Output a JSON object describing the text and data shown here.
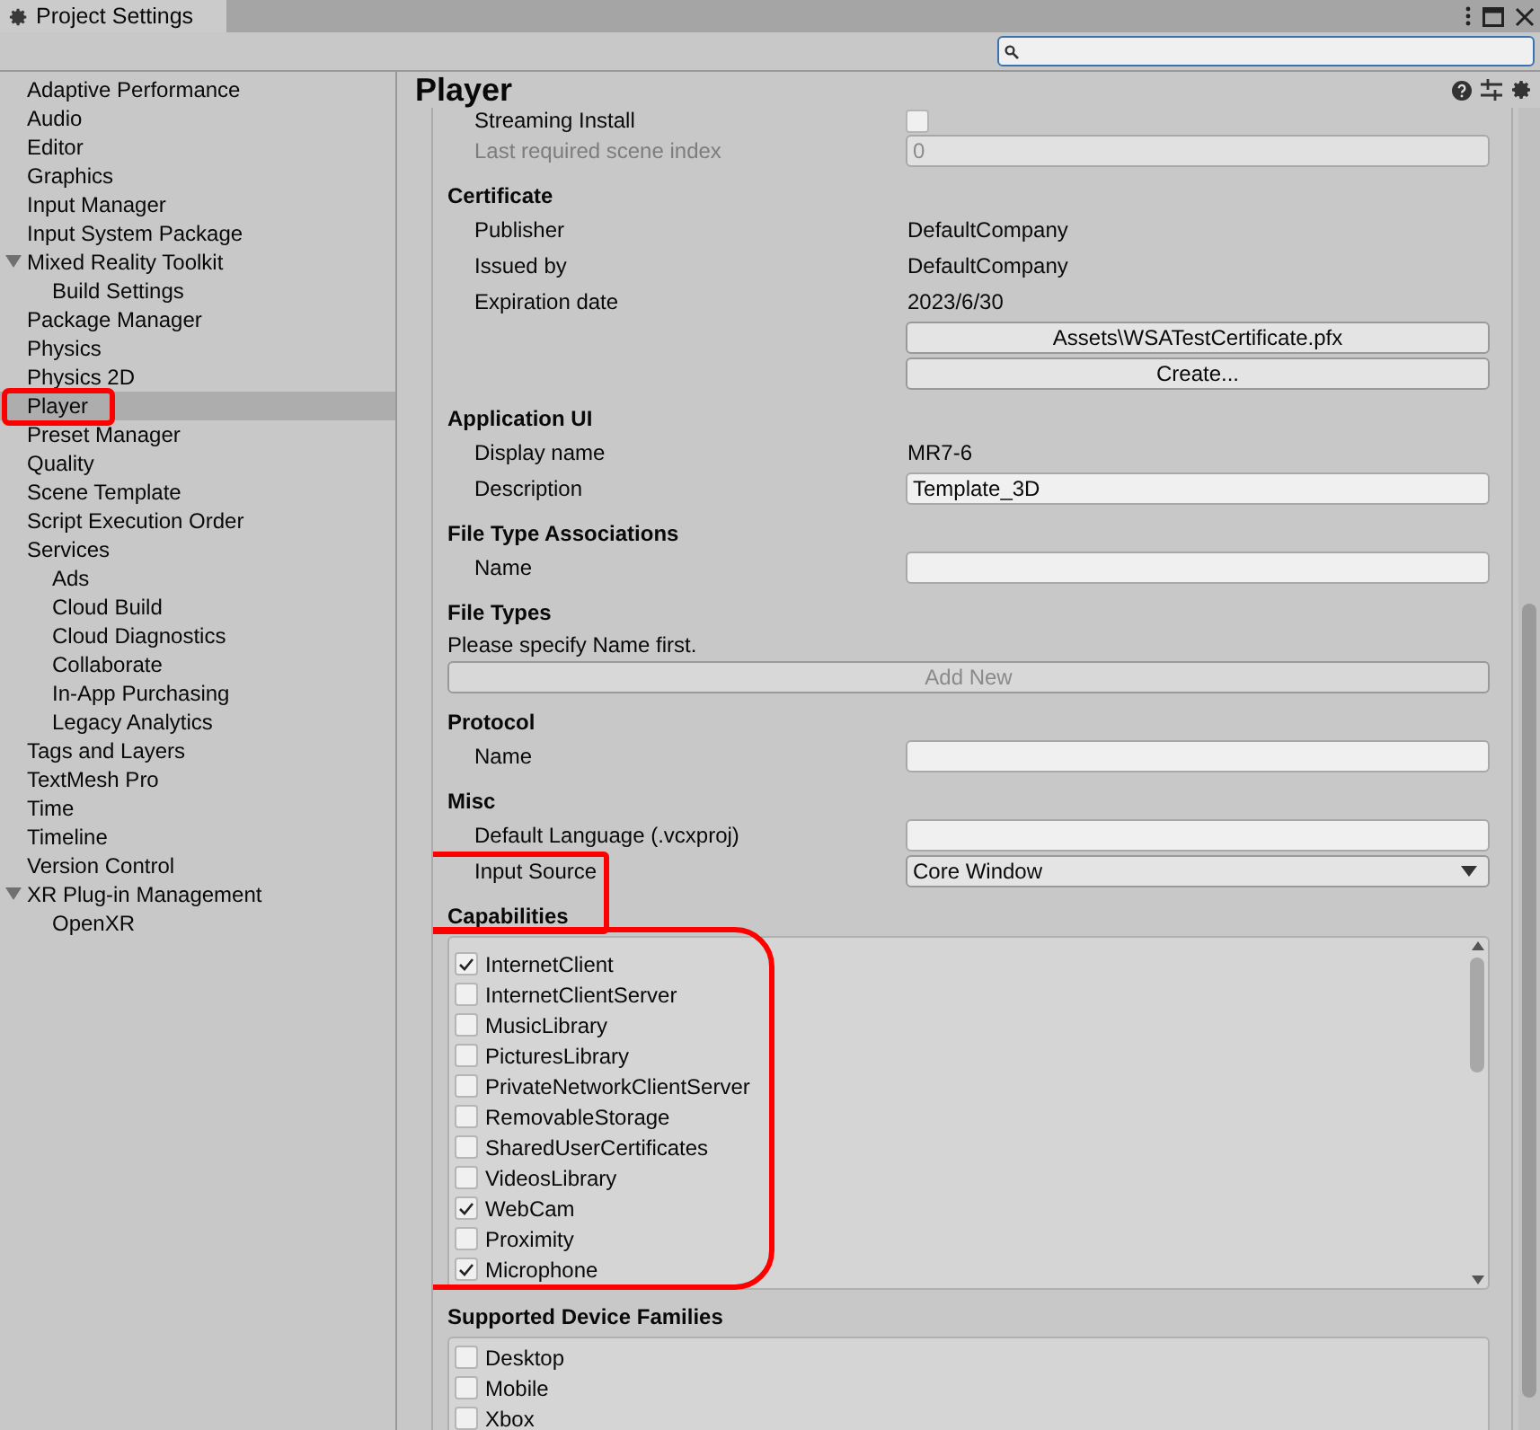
{
  "window": {
    "title": "Project Settings"
  },
  "sidebar": {
    "items": [
      {
        "label": "Adaptive Performance",
        "selected": false,
        "highlighted": false
      },
      {
        "label": "Audio",
        "selected": false,
        "highlighted": false
      },
      {
        "label": "Editor",
        "selected": false,
        "highlighted": false
      },
      {
        "label": "Graphics",
        "selected": false,
        "highlighted": false
      },
      {
        "label": "Input Manager",
        "selected": false,
        "highlighted": false
      },
      {
        "label": "Input System Package",
        "selected": false,
        "highlighted": false
      },
      {
        "label": "Mixed Reality Toolkit",
        "selected": false,
        "highlighted": false,
        "expanded": true,
        "children": [
          {
            "label": "Build Settings",
            "selected": false,
            "highlighted": false
          }
        ]
      },
      {
        "label": "Package Manager",
        "selected": false,
        "highlighted": false
      },
      {
        "label": "Physics",
        "selected": false,
        "highlighted": false
      },
      {
        "label": "Physics 2D",
        "selected": false,
        "highlighted": false
      },
      {
        "label": "Player",
        "selected": true,
        "highlighted": true
      },
      {
        "label": "Preset Manager",
        "selected": false,
        "highlighted": false
      },
      {
        "label": "Quality",
        "selected": false,
        "highlighted": false
      },
      {
        "label": "Scene Template",
        "selected": false,
        "highlighted": false
      },
      {
        "label": "Script Execution Order",
        "selected": false,
        "highlighted": false
      },
      {
        "label": "Services",
        "selected": false,
        "highlighted": false,
        "children": [
          {
            "label": "Ads",
            "selected": false,
            "highlighted": false
          },
          {
            "label": "Cloud Build",
            "selected": false,
            "highlighted": false
          },
          {
            "label": "Cloud Diagnostics",
            "selected": false,
            "highlighted": false
          },
          {
            "label": "Collaborate",
            "selected": false,
            "highlighted": false
          },
          {
            "label": "In-App Purchasing",
            "selected": false,
            "highlighted": false
          },
          {
            "label": "Legacy Analytics",
            "selected": false,
            "highlighted": false
          }
        ]
      },
      {
        "label": "Tags and Layers",
        "selected": false,
        "highlighted": false
      },
      {
        "label": "TextMesh Pro",
        "selected": false,
        "highlighted": false
      },
      {
        "label": "Time",
        "selected": false,
        "highlighted": false
      },
      {
        "label": "Timeline",
        "selected": false,
        "highlighted": false
      },
      {
        "label": "Version Control",
        "selected": false,
        "highlighted": false
      },
      {
        "label": "XR Plug-in Management",
        "selected": false,
        "highlighted": false,
        "expanded": true,
        "children": [
          {
            "label": "OpenXR",
            "selected": false,
            "highlighted": false
          }
        ]
      }
    ]
  },
  "panel": {
    "title": "Player",
    "sections": [
      {
        "rows": [
          {
            "kind": "toggle",
            "label": "Streaming Install",
            "checked": false
          },
          {
            "kind": "field",
            "label": "Last required scene index",
            "value": "0",
            "disabled": true
          }
        ]
      },
      {
        "heading": "Certificate",
        "highlighted": false,
        "rows": [
          {
            "kind": "info",
            "label": "Publisher",
            "value": "DefaultCompany"
          },
          {
            "kind": "info",
            "label": "Issued by",
            "value": "DefaultCompany"
          },
          {
            "kind": "info",
            "label": "Expiration date",
            "value": "2023/6/30"
          },
          {
            "kind": "button",
            "label": "Assets\\WSATestCertificate.pfx"
          },
          {
            "kind": "button",
            "label": "Create..."
          }
        ]
      },
      {
        "heading": "Application UI",
        "highlighted": false,
        "rows": [
          {
            "kind": "info",
            "label": "Display name",
            "value": "MR7-6"
          },
          {
            "kind": "field",
            "label": "Description",
            "value": "Template_3D",
            "disabled": false
          }
        ]
      },
      {
        "heading": "File Type Associations",
        "highlighted": false,
        "rows": [
          {
            "kind": "field",
            "label": "Name",
            "value": "",
            "disabled": false
          }
        ]
      },
      {
        "heading": "File Types",
        "highlighted": false,
        "rows": [
          {
            "kind": "note",
            "label": "Please specify Name first."
          },
          {
            "kind": "wide_button",
            "label": "Add New",
            "disabled": true
          }
        ]
      },
      {
        "heading": "Protocol",
        "highlighted": false,
        "rows": [
          {
            "kind": "field",
            "label": "Name",
            "value": "",
            "disabled": false
          }
        ]
      },
      {
        "heading": "Misc",
        "highlighted": false,
        "rows": [
          {
            "kind": "field",
            "label": "Default Language (.vcxproj)",
            "value": "",
            "disabled": false
          },
          {
            "kind": "dropdown",
            "label": "Input Source",
            "value": "Core Window"
          }
        ]
      },
      {
        "heading": "Capabilities",
        "highlighted": true,
        "rows": [
          {
            "kind": "checklist",
            "highlighted": true,
            "scrollable": true,
            "items": [
              {
                "label": "InternetClient",
                "checked": true
              },
              {
                "label": "InternetClientServer",
                "checked": false
              },
              {
                "label": "MusicLibrary",
                "checked": false
              },
              {
                "label": "PicturesLibrary",
                "checked": false
              },
              {
                "label": "PrivateNetworkClientServer",
                "checked": false
              },
              {
                "label": "RemovableStorage",
                "checked": false
              },
              {
                "label": "SharedUserCertificates",
                "checked": false
              },
              {
                "label": "VideosLibrary",
                "checked": false
              },
              {
                "label": "WebCam",
                "checked": true
              },
              {
                "label": "Proximity",
                "checked": false
              },
              {
                "label": "Microphone",
                "checked": true
              }
            ]
          }
        ]
      },
      {
        "heading": "Supported Device Families",
        "highlighted": false,
        "rows": [
          {
            "kind": "checklist",
            "highlighted": false,
            "scrollable": false,
            "items": [
              {
                "label": "Desktop",
                "checked": false
              },
              {
                "label": "Mobile",
                "checked": false
              },
              {
                "label": "Xbox",
                "checked": false
              }
            ]
          }
        ]
      }
    ]
  }
}
